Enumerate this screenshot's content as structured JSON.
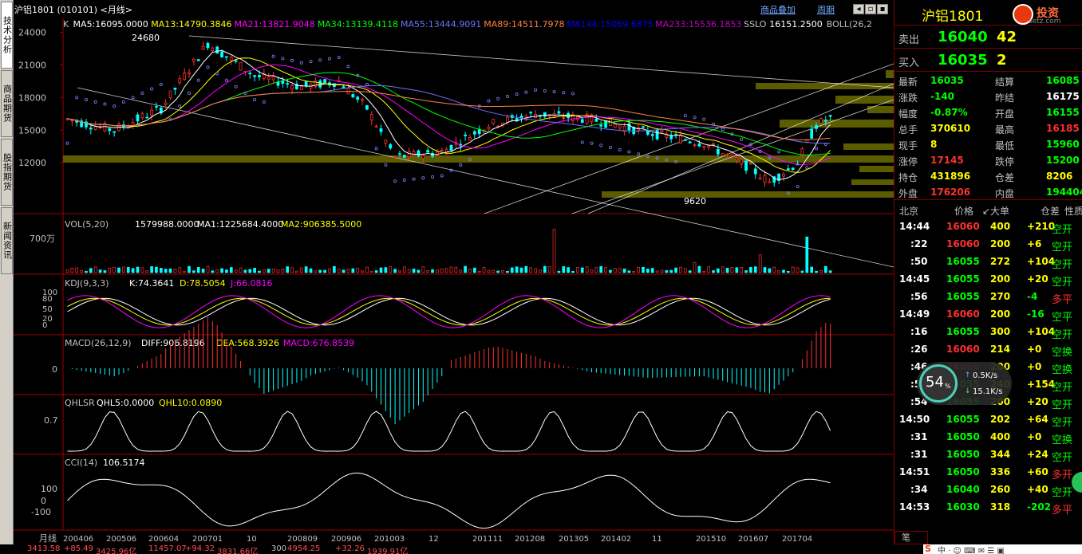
{
  "sidebar": {
    "tabs": [
      "技术分析",
      "商品期货",
      "股指期货",
      "新闻资讯"
    ]
  },
  "header": {
    "title": "沪铝1801 (010101) <月线>",
    "overlay_btn": "商品叠加",
    "period_btn": "周期"
  },
  "main_panel": {
    "indicator_line": [
      {
        "text": "K",
        "color": "#c0c0c0"
      },
      {
        "text": "MA5:16095.0000",
        "color": "#ffffff"
      },
      {
        "text": "MA13:14790.3846",
        "color": "#ffff00"
      },
      {
        "text": "MA21:13821.9048",
        "color": "#ff00ff"
      },
      {
        "text": "MA34:13139.4118",
        "color": "#00ff00"
      },
      {
        "text": "MA55:13444.9091",
        "color": "#6f6fff"
      },
      {
        "text": "MA89:14511.7978",
        "color": "#ff8040"
      },
      {
        "text": "MA144:15069.6875",
        "color": "#0000ff"
      },
      {
        "text": "MA233:15536.1853",
        "color": "#c000c0"
      },
      {
        "text": "SSLO",
        "color": "#c0c0c0"
      },
      {
        "text": "16151.2500",
        "color": "#ffffff"
      },
      {
        "text": "BOLL(26,2",
        "color": "#c0c0c0"
      }
    ],
    "yticks": [
      "24000",
      "21000",
      "18000",
      "15000",
      "12000"
    ],
    "high_label": "24680",
    "low_label": "9620"
  },
  "vol_panel": {
    "label": "VOL(5,20)",
    "value": "1579988.0000",
    "ma1": "MA1:1225684.4000",
    "ma2": "MA2:906385.5000",
    "ytick": "700万"
  },
  "kdj_panel": {
    "label": "KDJ(9,3,3)",
    "k": "K:74.3641",
    "d": "D:78.5054",
    "j": "J:66.0816",
    "yticks": [
      "100",
      "80",
      "50",
      "20",
      "0"
    ]
  },
  "macd_panel": {
    "label": "MACD(26,12,9)",
    "diff": "DIFF:906.8196",
    "dea": "DEA:568.3926",
    "macd": "MACD:676.8539",
    "ytick": "0"
  },
  "qhlsr_panel": {
    "label": "QHLSR",
    "qhl5": "QHL5:0.0000",
    "qhl10": "QHL10:0.0890",
    "ytick": "0.7"
  },
  "cci_panel": {
    "label": "CCI(14)",
    "value": "106.5174",
    "yticks": [
      "100",
      "0",
      "-100"
    ]
  },
  "xaxis": {
    "label": "月线",
    "ticks": [
      "200406",
      "200506",
      "200604",
      "200701",
      "10",
      "200809",
      "200906",
      "201003",
      "12",
      "201111",
      "201208",
      "201305",
      "201402",
      "11",
      "201510",
      "201607",
      "201704"
    ]
  },
  "quote": {
    "name": "沪铝1801",
    "watermark": "setz.com",
    "logo_text": "投资",
    "sell": {
      "label": "卖出",
      "price": "16040",
      "vol": "42"
    },
    "buy": {
      "label": "买入",
      "price": "16035",
      "vol": "2"
    },
    "rows": [
      {
        "l": "最新",
        "lv": "16035",
        "lc": "#00ff00",
        "r": "结算",
        "rv": "16085",
        "rc": "#00ff00"
      },
      {
        "l": "涨跌",
        "lv": "-140",
        "lc": "#00ff00",
        "r": "昨结",
        "rv": "16175",
        "rc": "#ffffff"
      },
      {
        "l": "幅度",
        "lv": "-0.87%",
        "lc": "#00ff00",
        "r": "开盘",
        "rv": "16155",
        "rc": "#00ff00"
      },
      {
        "l": "总手",
        "lv": "370610",
        "lc": "#ffff00",
        "r": "最高",
        "rv": "16185",
        "rc": "#ff3030"
      },
      {
        "l": "现手",
        "lv": "8",
        "lc": "#ffff00",
        "r": "最低",
        "rv": "15960",
        "rc": "#00ff00"
      },
      {
        "l": "涨停",
        "lv": "17145",
        "lc": "#ff3030",
        "r": "跌停",
        "rv": "15200",
        "rc": "#00ff00"
      },
      {
        "l": "持仓",
        "lv": "431896",
        "lc": "#ffff00",
        "r": "仓差",
        "rv": "8206",
        "rc": "#ffff00"
      },
      {
        "l": "外盘",
        "lv": "176206",
        "lc": "#ff3030",
        "r": "内盘",
        "rv": "194404",
        "rc": "#00ff00"
      }
    ],
    "ticks_header": [
      "北京",
      "价格",
      "↙大单",
      "仓差",
      "性质"
    ],
    "ticks": [
      {
        "t": "14:44",
        "p": "16060",
        "pc": "#ff3030",
        "v": "400",
        "d": "+210",
        "n": "空开"
      },
      {
        "t": ":22",
        "p": "16060",
        "pc": "#ff3030",
        "v": "200",
        "d": "+6",
        "n": "空开"
      },
      {
        "t": ":50",
        "p": "16055",
        "pc": "#00ff00",
        "v": "272",
        "d": "+104",
        "n": "空开"
      },
      {
        "t": "14:45",
        "p": "16055",
        "pc": "#00ff00",
        "v": "200",
        "d": "+20",
        "n": "空开"
      },
      {
        "t": ":56",
        "p": "16055",
        "pc": "#00ff00",
        "v": "270",
        "d": "-4",
        "n": "多平"
      },
      {
        "t": "14:49",
        "p": "16060",
        "pc": "#ff3030",
        "v": "200",
        "d": "-16",
        "n": "空平"
      },
      {
        "t": ":16",
        "p": "16055",
        "pc": "#00ff00",
        "v": "300",
        "d": "+104",
        "n": "空开"
      },
      {
        "t": ":26",
        "p": "16060",
        "pc": "#ff3030",
        "v": "214",
        "d": "+0",
        "n": "空换"
      },
      {
        "t": ":46",
        "p": "16060",
        "pc": "#ff3030",
        "v": "200",
        "d": "+0",
        "n": "空换"
      },
      {
        "t": ":51",
        "p": "16055",
        "pc": "#00ff00",
        "v": "240",
        "d": "+154",
        "n": "空开"
      },
      {
        "t": ":54",
        "p": "16055",
        "pc": "#00ff00",
        "v": "200",
        "d": "+20",
        "n": "空开"
      },
      {
        "t": "14:50",
        "p": "16055",
        "pc": "#00ff00",
        "v": "202",
        "d": "+64",
        "n": "空开"
      },
      {
        "t": ":31",
        "p": "16050",
        "pc": "#00ff00",
        "v": "400",
        "d": "+0",
        "n": "空换"
      },
      {
        "t": ":31",
        "p": "16050",
        "pc": "#00ff00",
        "v": "344",
        "d": "+24",
        "n": "空开"
      },
      {
        "t": "14:51",
        "p": "16050",
        "pc": "#00ff00",
        "v": "336",
        "d": "+60",
        "n": "多开"
      },
      {
        "t": ":34",
        "p": "16040",
        "pc": "#00ff00",
        "v": "260",
        "d": "+40",
        "n": "空开"
      },
      {
        "t": "14:53",
        "p": "16030",
        "pc": "#00ff00",
        "v": "318",
        "d": "-202",
        "n": "多平"
      }
    ],
    "bottom_tab": "笔"
  },
  "net_widget": {
    "percent": "54",
    "pct_sign": "%",
    "up": "0.5K/s",
    "down": "15.1K/s"
  },
  "statusbar": [
    "3413.58",
    "+85.49",
    "3425.96亿",
    "11457.07",
    "+94.32",
    "3831.66亿",
    "300",
    "4954.25",
    "+32.26",
    "1939.91亿"
  ]
}
